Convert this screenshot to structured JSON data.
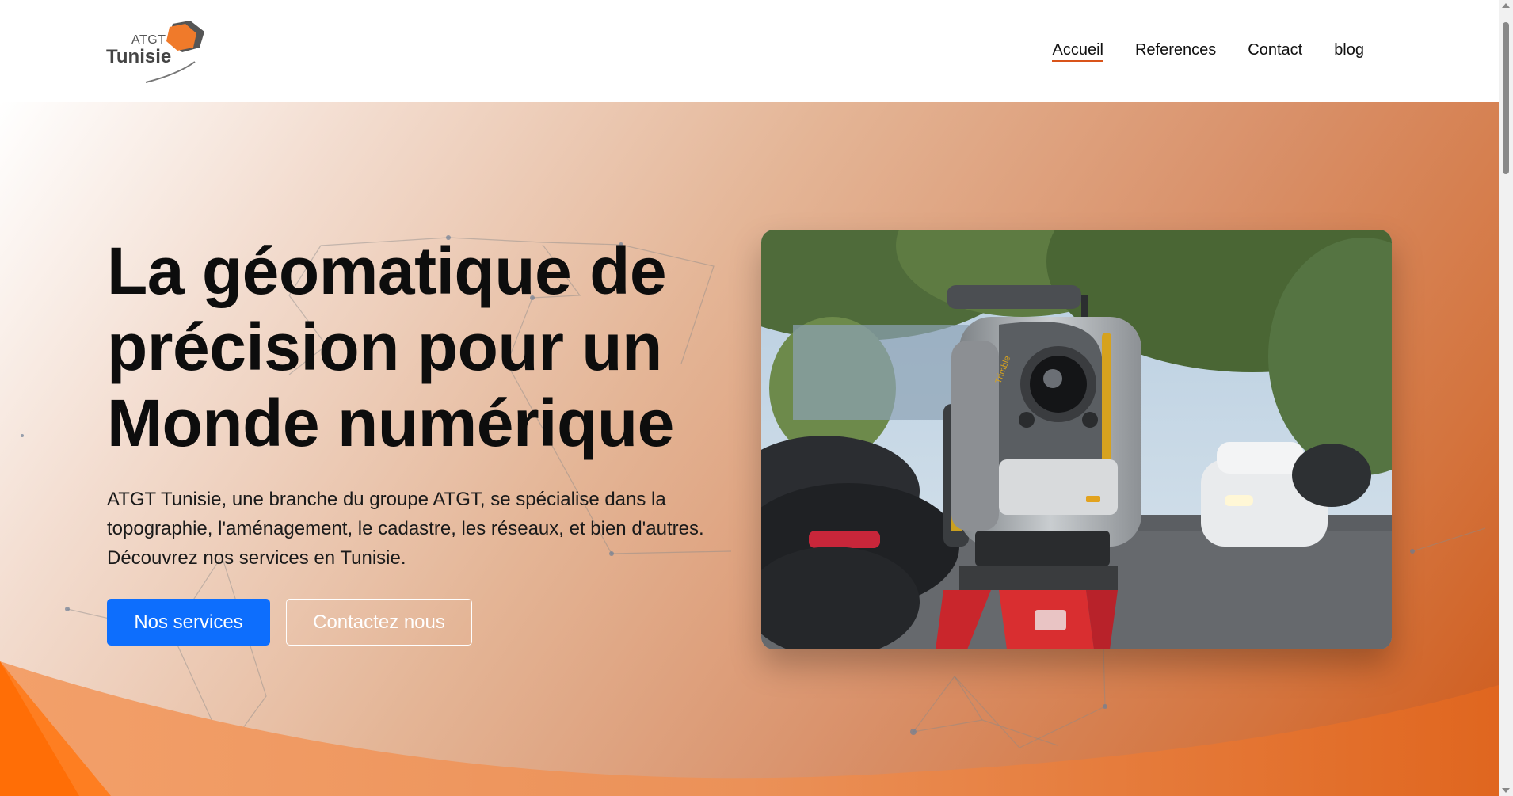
{
  "header": {
    "logo": {
      "line1": "ATGT",
      "line2": "Tunisie"
    },
    "nav": [
      {
        "label": "Accueil",
        "active": true
      },
      {
        "label": "References",
        "active": false
      },
      {
        "label": "Contact",
        "active": false
      },
      {
        "label": "blog",
        "active": false
      }
    ]
  },
  "hero": {
    "title_lines": [
      "La géomatique de",
      "précision pour un",
      "Monde numérique"
    ],
    "description_lines": [
      "ATGT Tunisie, une branche du groupe ATGT, se spécialise dans la",
      "topographie, l'aménagement, le cadastre, les réseaux, et bien d'autres.",
      "Découvrez nos services en Tunisie."
    ],
    "primary_button": "Nos services",
    "secondary_button": "Contactez nous",
    "photo_brand": "Trimble"
  },
  "colors": {
    "accent": "#d9541a",
    "primary_button": "#0d6efd",
    "logo_orange": "#f07a2a",
    "hero_gradient_end": "#cf5a1a"
  }
}
